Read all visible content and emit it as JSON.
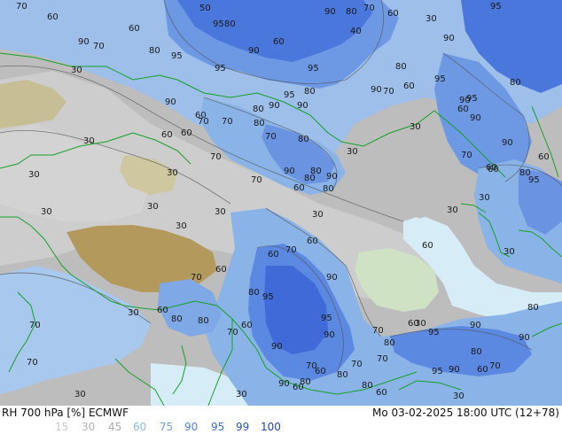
{
  "product": {
    "title": "RH 700 hPa [%] ECMWF",
    "valid_time": "Mo 03-02-2025 18:00 UTC (12+78)"
  },
  "legend": {
    "items": [
      {
        "label": "15",
        "color": "#c8c8c8"
      },
      {
        "label": "30",
        "color": "#b4b4b4"
      },
      {
        "label": "45",
        "color": "#a8a8a8"
      },
      {
        "label": "60",
        "color": "#8fb8e8"
      },
      {
        "label": "75",
        "color": "#6fa0e0"
      },
      {
        "label": "90",
        "color": "#4f84d8"
      },
      {
        "label": "95",
        "color": "#3a6cd0"
      },
      {
        "label": "99",
        "color": "#2a58c0"
      },
      {
        "label": "100",
        "color": "#1e46b0"
      }
    ]
  },
  "colors": {
    "rh_very_low": "#c8c8c8",
    "rh_low": "#a9a9a9",
    "rh_mid": "#bcd3ee",
    "rh_high": "#8ab4e8",
    "rh_very_high": "#5583e0",
    "rh_saturated": "#3d6ad8",
    "sea": "#d6ecf7",
    "terrain_high": "#b39a5c",
    "terrain_mid": "#c8be95",
    "lowland": "#cfe3c4",
    "borders": "#16a028",
    "contour": "#555555"
  },
  "contour_labels": [
    "70",
    "60",
    "90",
    "80",
    "95",
    "30",
    "60",
    "90",
    "70",
    "95",
    "80",
    "60",
    "50",
    "90",
    "80",
    "70",
    "60",
    "30",
    "40",
    "90",
    "95",
    "80",
    "60",
    "80",
    "70",
    "90",
    "95",
    "80",
    "95",
    "95",
    "60",
    "90",
    "60",
    "70",
    "95",
    "90",
    "80",
    "70",
    "80",
    "90",
    "60",
    "30",
    "30",
    "80",
    "60",
    "70",
    "90",
    "80",
    "70",
    "30",
    "80",
    "70",
    "90",
    "80",
    "60",
    "90",
    "60",
    "30",
    "30",
    "30",
    "30",
    "95",
    "90",
    "60",
    "30",
    "30",
    "90",
    "60",
    "30",
    "60",
    "30",
    "60",
    "80",
    "30",
    "60",
    "70",
    "30",
    "70",
    "80",
    "95",
    "95",
    "60",
    "70",
    "60",
    "80",
    "80",
    "70",
    "90",
    "95",
    "90",
    "90",
    "30",
    "70",
    "60",
    "80",
    "80",
    "60",
    "70",
    "70",
    "30",
    "95",
    "80",
    "90",
    "70",
    "70",
    "80",
    "60",
    "90",
    "95",
    "70",
    "70",
    "60",
    "90",
    "60",
    "30",
    "30",
    "80",
    "60",
    "80",
    "90",
    "30"
  ]
}
